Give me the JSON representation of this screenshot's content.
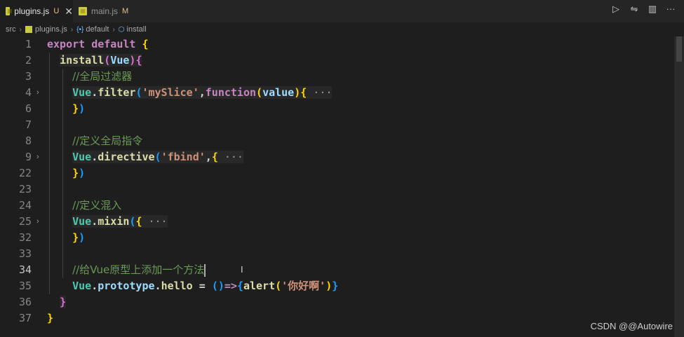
{
  "tabs": [
    {
      "name": "plugins.js",
      "status": "U",
      "active": true,
      "close": "✕"
    },
    {
      "name": "main.js",
      "status": "M",
      "active": false
    }
  ],
  "actions": [
    {
      "icon": "run-icon",
      "glyph": "▷"
    },
    {
      "icon": "split-compare-icon",
      "glyph": "⇋"
    },
    {
      "icon": "split-editor-icon",
      "glyph": "▥"
    },
    {
      "icon": "more-icon",
      "glyph": "···"
    }
  ],
  "breadcrumb": [
    "src",
    "plugins.js",
    "default",
    "install"
  ],
  "editor": {
    "lines": [
      {
        "num": "1",
        "tokens": [
          [
            "kw",
            "export"
          ],
          [
            "pun",
            " "
          ],
          [
            "kw",
            "default"
          ],
          [
            "pun",
            " "
          ],
          [
            "br1",
            "{"
          ]
        ]
      },
      {
        "num": "2",
        "tokens": [
          [
            "pun",
            "  "
          ],
          [
            "fn",
            "install"
          ],
          [
            "br2",
            "("
          ],
          [
            "var",
            "Vue"
          ],
          [
            "br2",
            ")"
          ],
          [
            "br2",
            "{"
          ]
        ],
        "highlight": true
      },
      {
        "num": "3",
        "tokens": [
          [
            "pun",
            "    "
          ],
          [
            "com",
            "//全局过滤器"
          ]
        ]
      },
      {
        "num": "4",
        "fold": true,
        "tokens": [
          [
            "pun",
            "    "
          ],
          [
            "cls",
            "Vue"
          ],
          [
            "pun",
            "."
          ],
          [
            "fn",
            "filter"
          ],
          [
            "br3",
            "("
          ],
          [
            "str",
            "'mySlice'"
          ],
          [
            "pun",
            ","
          ],
          [
            "kw",
            "function"
          ],
          [
            "br1",
            "("
          ],
          [
            "var",
            "value"
          ],
          [
            "br1",
            ")"
          ],
          [
            "br1",
            "{"
          ],
          [
            "ell",
            " ···"
          ]
        ],
        "highlight": true
      },
      {
        "num": "6",
        "tokens": [
          [
            "pun",
            "    "
          ],
          [
            "br1",
            "}"
          ],
          [
            "br3",
            ")"
          ]
        ]
      },
      {
        "num": "7",
        "tokens": []
      },
      {
        "num": "8",
        "tokens": [
          [
            "pun",
            "    "
          ],
          [
            "com",
            "//定义全局指令"
          ]
        ]
      },
      {
        "num": "9",
        "fold": true,
        "tokens": [
          [
            "pun",
            "    "
          ],
          [
            "cls",
            "Vue"
          ],
          [
            "pun",
            "."
          ],
          [
            "fn",
            "directive"
          ],
          [
            "br3",
            "("
          ],
          [
            "str",
            "'fbind'"
          ],
          [
            "pun",
            ","
          ],
          [
            "br1",
            "{"
          ],
          [
            "ell",
            " ···"
          ]
        ],
        "highlight": true
      },
      {
        "num": "22",
        "tokens": [
          [
            "pun",
            "    "
          ],
          [
            "br1",
            "}"
          ],
          [
            "br3",
            ")"
          ]
        ]
      },
      {
        "num": "23",
        "tokens": []
      },
      {
        "num": "24",
        "tokens": [
          [
            "pun",
            "    "
          ],
          [
            "com",
            "//定义混入"
          ]
        ]
      },
      {
        "num": "25",
        "fold": true,
        "tokens": [
          [
            "pun",
            "    "
          ],
          [
            "cls",
            "Vue"
          ],
          [
            "pun",
            "."
          ],
          [
            "fn",
            "mixin"
          ],
          [
            "br3",
            "("
          ],
          [
            "br1",
            "{"
          ],
          [
            "ell",
            " ···"
          ]
        ],
        "highlight": true
      },
      {
        "num": "32",
        "tokens": [
          [
            "pun",
            "    "
          ],
          [
            "br1",
            "}"
          ],
          [
            "br3",
            ")"
          ]
        ]
      },
      {
        "num": "33",
        "tokens": []
      },
      {
        "num": "34",
        "current": true,
        "caret": true,
        "tokens": [
          [
            "pun",
            "    "
          ],
          [
            "com",
            "//给Vue原型上添加一个方法"
          ]
        ]
      },
      {
        "num": "35",
        "tokens": [
          [
            "pun",
            "    "
          ],
          [
            "cls",
            "Vue"
          ],
          [
            "pun",
            "."
          ],
          [
            "prop",
            "prototype"
          ],
          [
            "pun",
            "."
          ],
          [
            "fn",
            "hello"
          ],
          [
            "pun",
            " = "
          ],
          [
            "br3",
            "()"
          ],
          [
            "kw",
            "=>"
          ],
          [
            "br3",
            "{"
          ],
          [
            "fn",
            "alert"
          ],
          [
            "br1",
            "("
          ],
          [
            "str",
            "'你好啊'"
          ],
          [
            "br1",
            ")"
          ],
          [
            "br3",
            "}"
          ]
        ]
      },
      {
        "num": "36",
        "tokens": [
          [
            "pun",
            "  "
          ],
          [
            "br2",
            "}"
          ]
        ],
        "highlight": true
      },
      {
        "num": "37",
        "tokens": [
          [
            "br1",
            "}"
          ]
        ]
      }
    ]
  },
  "watermark": "CSDN @@Autowire"
}
